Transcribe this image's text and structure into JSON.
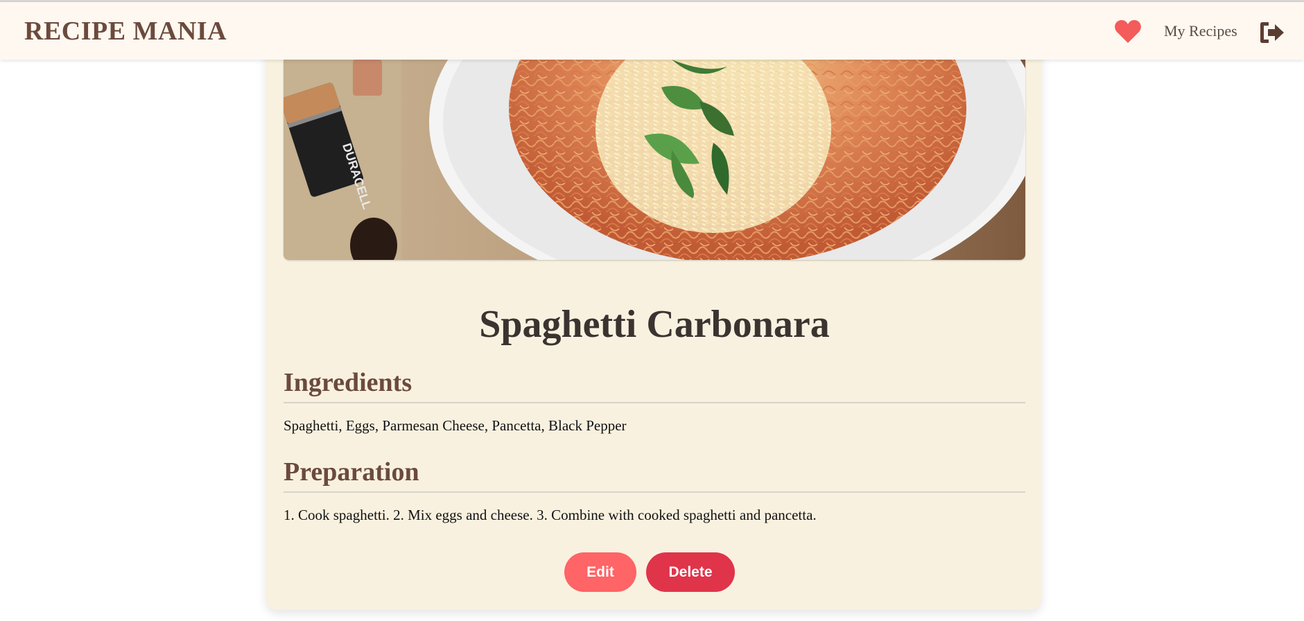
{
  "navbar": {
    "brand": "RECIPE MANIA",
    "my_recipes_label": "My Recipes",
    "heart_icon": "heart-icon",
    "logout_icon": "logout-icon",
    "colors": {
      "heart": "#f45b5b",
      "brand": "#6b4a3d",
      "background": "#fff8f0"
    }
  },
  "recipe": {
    "title": "Spaghetti Carbonara",
    "ingredients_heading": "Ingredients",
    "ingredients": "Spaghetti, Eggs, Parmesan Cheese, Pancetta, Black Pepper",
    "preparation_heading": "Preparation",
    "preparation": "1. Cook spaghetti. 2. Mix eggs and cheese. 3. Combine with cooked spaghetti and pancetta."
  },
  "actions": {
    "edit_label": "Edit",
    "delete_label": "Delete",
    "colors": {
      "edit": "#ff6466",
      "delete": "#e0344a"
    }
  },
  "photo": {
    "battery_text": "DURACELL"
  }
}
